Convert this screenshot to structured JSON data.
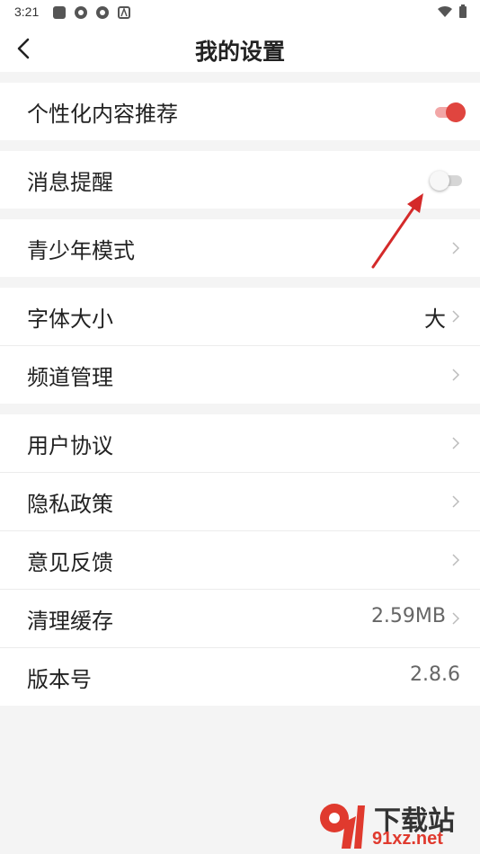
{
  "status": {
    "time": "3:21"
  },
  "header": {
    "title": "我的设置"
  },
  "groups": [
    {
      "items": [
        {
          "label": "个性化内容推荐",
          "toggle": "on"
        }
      ]
    },
    {
      "items": [
        {
          "label": "消息提醒",
          "toggle": "off"
        }
      ]
    },
    {
      "items": [
        {
          "label": "青少年模式"
        }
      ]
    },
    {
      "items": [
        {
          "label": "字体大小",
          "value": "大"
        },
        {
          "label": "频道管理"
        }
      ]
    },
    {
      "items": [
        {
          "label": "用户协议"
        },
        {
          "label": "隐私政策"
        },
        {
          "label": "意见反馈"
        },
        {
          "label": "清理缓存",
          "value": "2.59MB"
        },
        {
          "label": "版本号",
          "value": "2.8.6"
        }
      ]
    }
  ],
  "watermark": {
    "text": "下载站",
    "url": "91xz.net"
  },
  "colors": {
    "accent": "#e0453f",
    "background": "#f4f4f4"
  }
}
